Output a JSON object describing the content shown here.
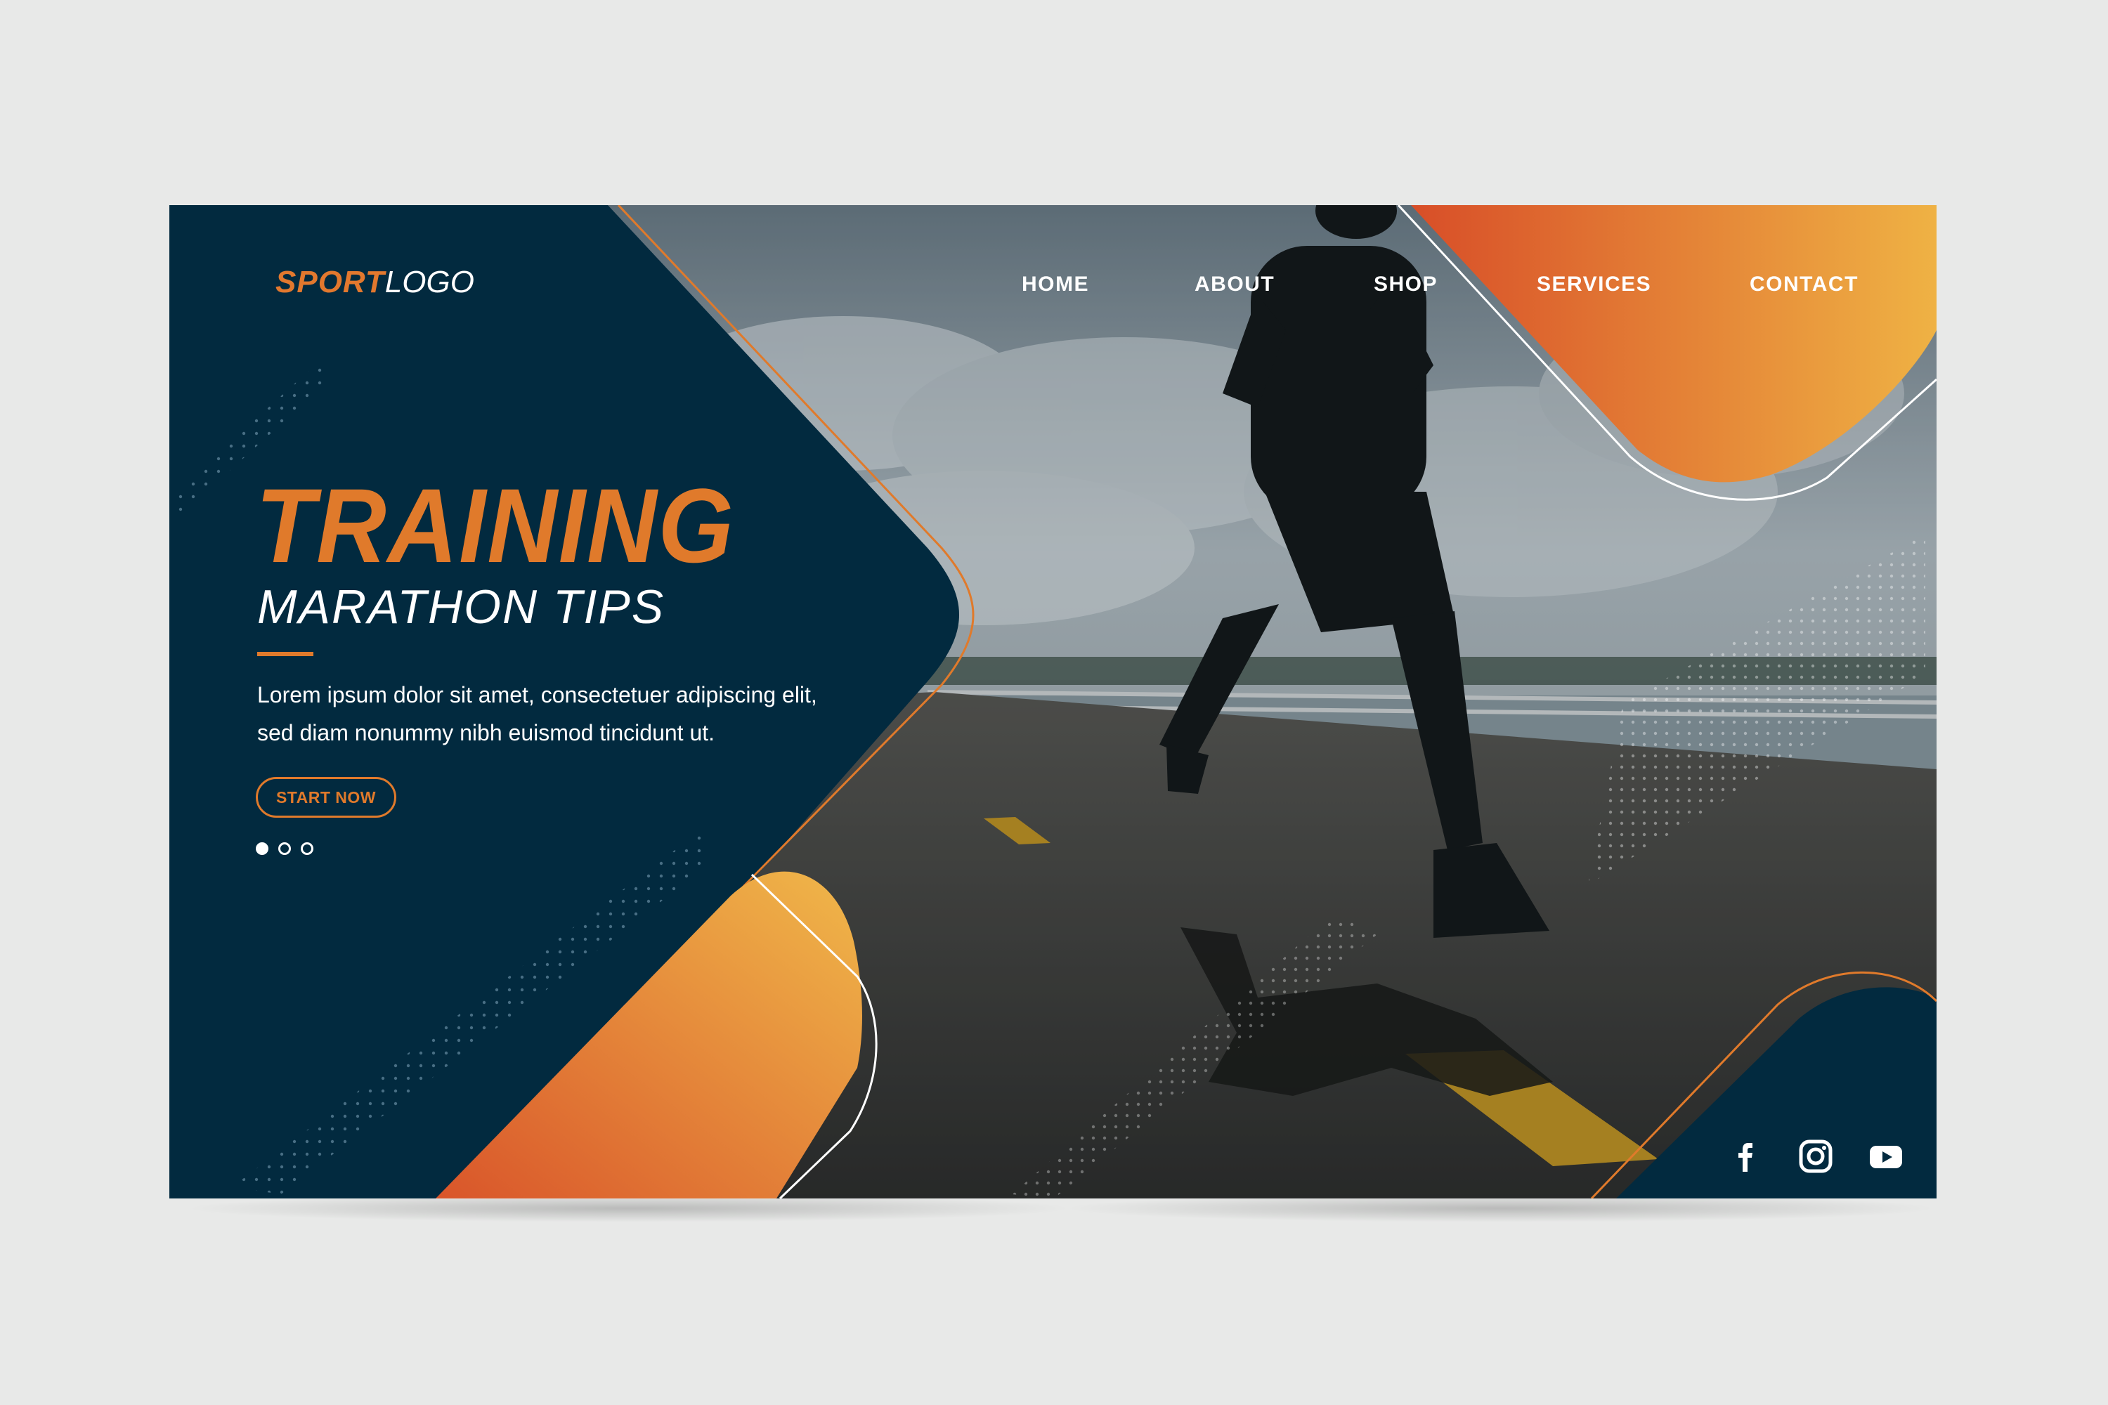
{
  "logo": {
    "part1": "SPORT",
    "part2": "LOGO"
  },
  "nav": {
    "home": "HOME",
    "about": "ABOUT",
    "shop": "SHOP",
    "services": "SERVICES",
    "contact": "CONTACT"
  },
  "hero": {
    "title": "TRAINING",
    "subtitle": "MARATHON TIPS",
    "body": "Lorem ipsum dolor sit amet, consectetuer adipiscing elit, sed diam nonummy nibh euismod tincidunt ut.",
    "cta_label": "START NOW"
  },
  "carousel": {
    "slides": 3,
    "active": 1
  },
  "social": [
    "facebook-icon",
    "instagram-icon",
    "youtube-icon"
  ],
  "colors": {
    "navy": "#022a3f",
    "orange": "#e07a2b",
    "gold": "#edb244",
    "frame_bg": "#e8e9e8"
  }
}
